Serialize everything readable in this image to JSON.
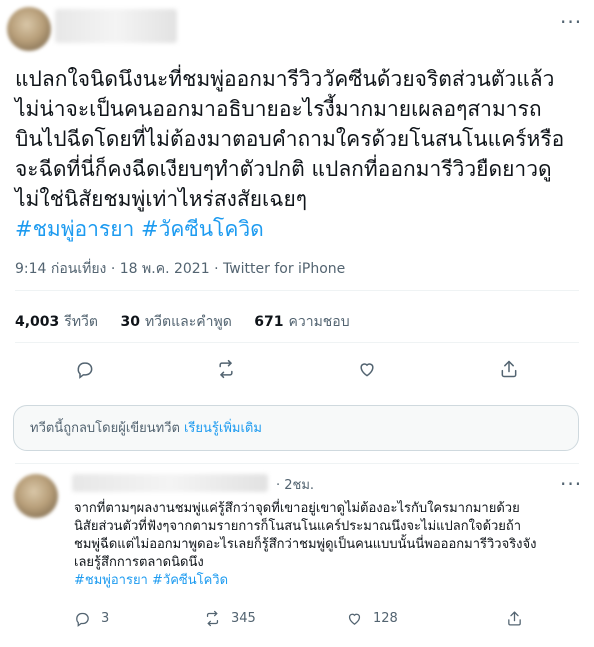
{
  "tweet": {
    "text_lines": [
      "แปลกใจนิดนึงนะที่ชมพู่ออกมารีวิววัคซีนด้วยจริตส่วนตัวแล้ว",
      "ไม่น่าจะเป็นคนออกมาอธิบายอะไรงี้มากมายเผลอๆสามารถ",
      "บินไปฉีดโดยที่ไม่ต้องมาตอบคำถามใครด้วยโนสนโนแคร์หรือ",
      "จะฉีดที่นี่ก็คงฉีดเงียบๆทำตัวปกติ แปลกที่ออกมารีวิวยืดยาวดู",
      "ไม่ใช่นิสัยชมพู่เท่าไหร่สงสัยเฉยๆ"
    ],
    "hashtags": [
      "#ชมพู่อารยา",
      "#วัคซีนโควิด"
    ],
    "time": "9:14 ก่อนเที่ยง",
    "dot": "·",
    "date": "18 พ.ค. 2021",
    "source": "Twitter for iPhone",
    "stats": {
      "retweets_count": "4,003",
      "retweets_label": "รีทวีต",
      "quotes_count": "30",
      "quotes_label": "ทวีตและคำพูด",
      "likes_count": "671",
      "likes_label": "ความชอบ"
    },
    "more_label": "···"
  },
  "notice": {
    "text": "ทวีตนี้ถูกลบโดยผู้เขียนทวีต",
    "link": "เรียนรู้เพิ่มเติม"
  },
  "reply": {
    "time": "· 2ชม.",
    "text_lines": [
      "จากที่ตามๆผลงานชมพู่แค่รู้สึกว่าจุดที่เขาอยู่เขาดูไม่ต้องอะไรกับใครมากมายด้วย",
      "นิสัยส่วนตัวที่ฟังๆจากตามรายการก็โนสนโนแคร์ประมาณนึงจะไม่แปลกใจด้วยถ้า",
      "ชมพู่ฉีดแต่ไม่ออกมาพูดอะไรเลยก็รู้สึกว่าชมพู่ดูเป็นคนแบบนั้นนี่พอออกมารีวิวจริงจัง",
      "เลยรู้สึกการตลาดนิดนึง"
    ],
    "hashtags": [
      "#ชมพู่อารยา",
      "#วัคซีนโควิด"
    ],
    "reply_count": "3",
    "retweet_count": "345",
    "like_count": "128"
  },
  "icons": {
    "reply": "comment-icon",
    "retweet": "retweet-icon",
    "like": "heart-icon",
    "share": "share-icon",
    "more": "more-icon"
  },
  "colors": {
    "text": "#0f1419",
    "secondary": "#536471",
    "link": "#1d9bf0",
    "border": "#eff3f4"
  }
}
